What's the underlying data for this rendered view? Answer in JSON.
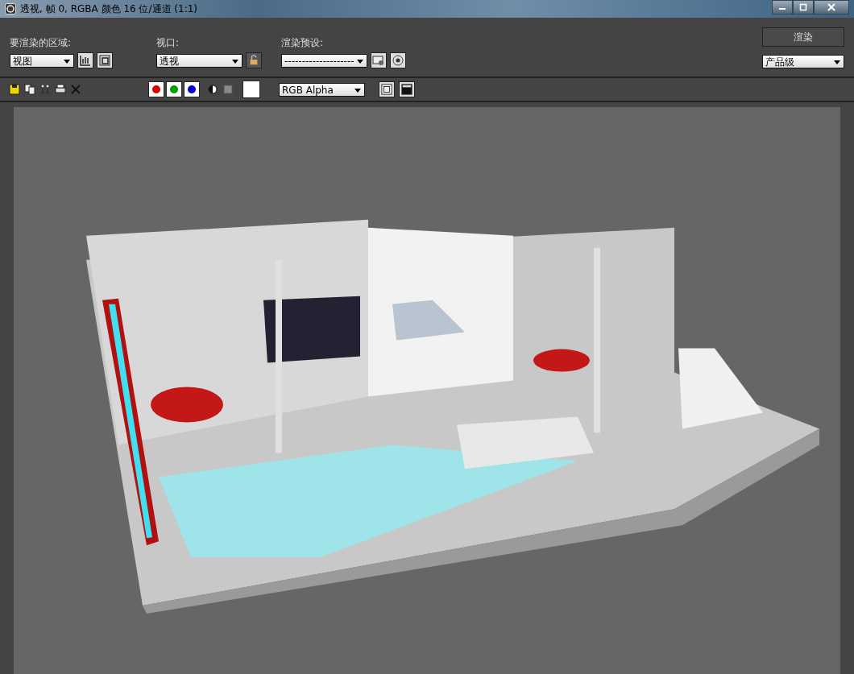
{
  "window": {
    "title": "透视, 帧 0, RGBA 颜色 16 位/通道 (1:1)"
  },
  "area": {
    "label": "要渲染的区域:",
    "value": "视图"
  },
  "viewport": {
    "label": "视口:",
    "value": "透视"
  },
  "preset": {
    "label": "渲染预设:",
    "value": "--------------------"
  },
  "render_button": "渲染",
  "quality": {
    "value": "产品级"
  },
  "channels": [
    {
      "color": "#e00000",
      "on": true
    },
    {
      "color": "#00a000",
      "on": true
    },
    {
      "color": "#0000d0",
      "on": true
    }
  ],
  "display": {
    "value": "RGB Alpha"
  }
}
